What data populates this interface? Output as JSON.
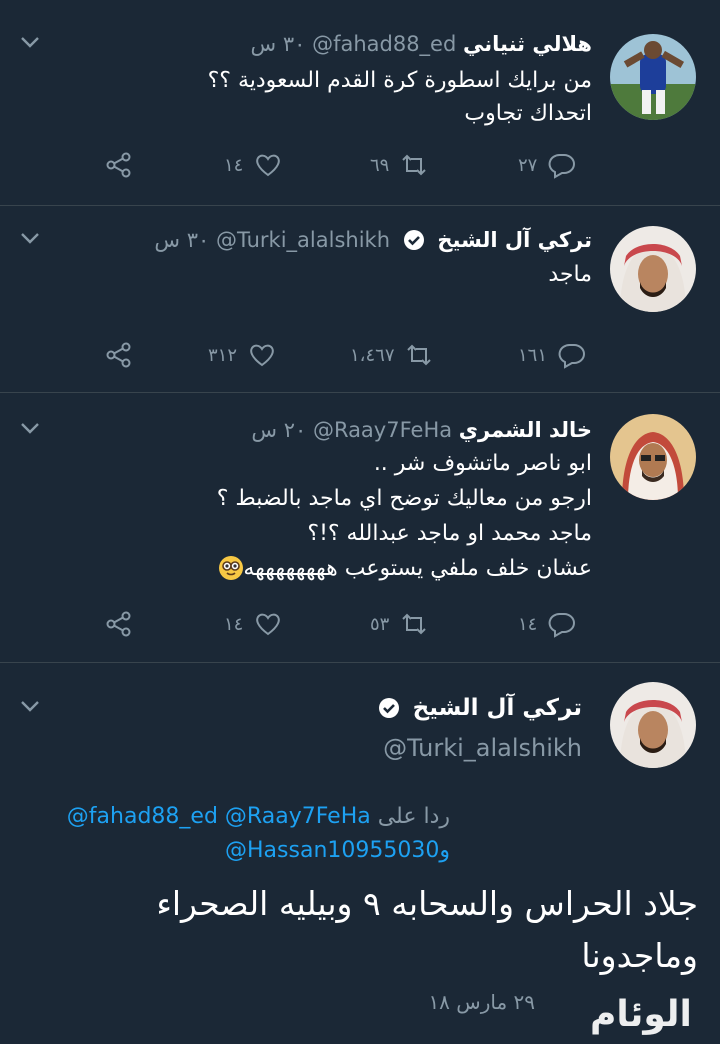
{
  "tweets": [
    {
      "name": "هلالي ثنياني",
      "handle": "@fahad88_ed",
      "time": "٣٠ س",
      "lines": [
        "من برايك اسطورة كرة القدم السعودية ؟؟",
        "اتحداك تجاوب"
      ],
      "replies": "٢٧",
      "retweets": "٦٩",
      "likes": "١٤",
      "avatar": "player-photo",
      "verified": false
    },
    {
      "name": "تركي آل الشيخ",
      "handle": "@Turki_alalshikh",
      "time": "٣٠ س",
      "lines": [
        "ماجد"
      ],
      "replies": "١٦١",
      "retweets": "١،٤٦٧",
      "likes": "٣١٢",
      "avatar": "man-in-shemagh-photo",
      "verified": true
    },
    {
      "name": "خالد الشمري",
      "handle": "@Raay7FeHa",
      "time": "٢٠ س",
      "lines": [
        "ابو ناصر ماتشوف شر ..",
        "ارجو من معاليك توضح اي ماجد بالضبط ؟",
        "ماجد محمد او ماجد عبدالله ؟!؟",
        "عشان خلف ملفي يستوعب ههههههههه"
      ],
      "replies": "١٤",
      "retweets": "٥٣",
      "likes": "١٤",
      "avatar": "man-in-shemagh-photo",
      "verified": false
    }
  ],
  "main_tweet": {
    "name": "تركي آل الشيخ",
    "handle": "@Turki_alalshikh",
    "reply_prefix": "ردا على",
    "mention_1": "@fahad88_ed",
    "mention_2": "@Raay7FeHa",
    "and": "و",
    "mention_3": "@Hassan10955030",
    "text_line_1": "جلاد الحراس والسحابه ٩ وبيليه الصحراء",
    "text_line_2": "وماجدونا",
    "date": "٢٩ مارس ١٨"
  },
  "watermark": "الوئام",
  "colors": {
    "background": "#1b2836",
    "muted": "#8899a6",
    "link": "#1da1f2",
    "divider": "#38444d"
  }
}
